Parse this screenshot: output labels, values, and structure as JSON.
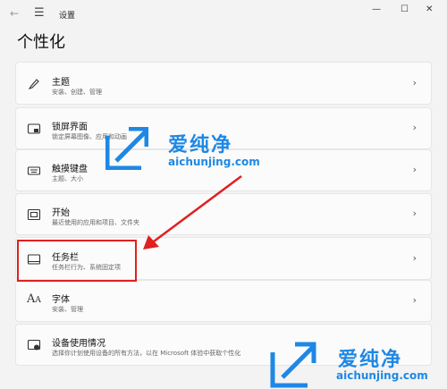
{
  "window": {
    "title": "设置",
    "back_icon": "back-arrow-icon",
    "menu_icon": "hamburger-menu-icon"
  },
  "page": {
    "title": "个性化"
  },
  "items": [
    {
      "title": "主题",
      "subtitle": "安装、创建、管理",
      "icon": "paintbrush-icon"
    },
    {
      "title": "锁屏界面",
      "subtitle": "锁定屏幕图像、应用和动画",
      "icon": "lockscreen-icon"
    },
    {
      "title": "触摸键盘",
      "subtitle": "主题、大小",
      "icon": "keyboard-icon"
    },
    {
      "title": "开始",
      "subtitle": "最近使用的应用和项目、文件夹",
      "icon": "start-icon"
    },
    {
      "title": "任务栏",
      "subtitle": "任务栏行为、系统固定项",
      "icon": "taskbar-icon"
    },
    {
      "title": "字体",
      "subtitle": "安装、管理",
      "icon": "font-icon"
    },
    {
      "title": "设备使用情况",
      "subtitle": "选择你计划使用设备的所有方法，以在 Microsoft 体验中获取个性化",
      "icon": "device-usage-icon"
    }
  ],
  "watermark": {
    "brand": "爱纯净",
    "site": "aichunjing.com"
  },
  "colors": {
    "highlight": "#e02020",
    "watermark_blue": "#1e88e5"
  }
}
